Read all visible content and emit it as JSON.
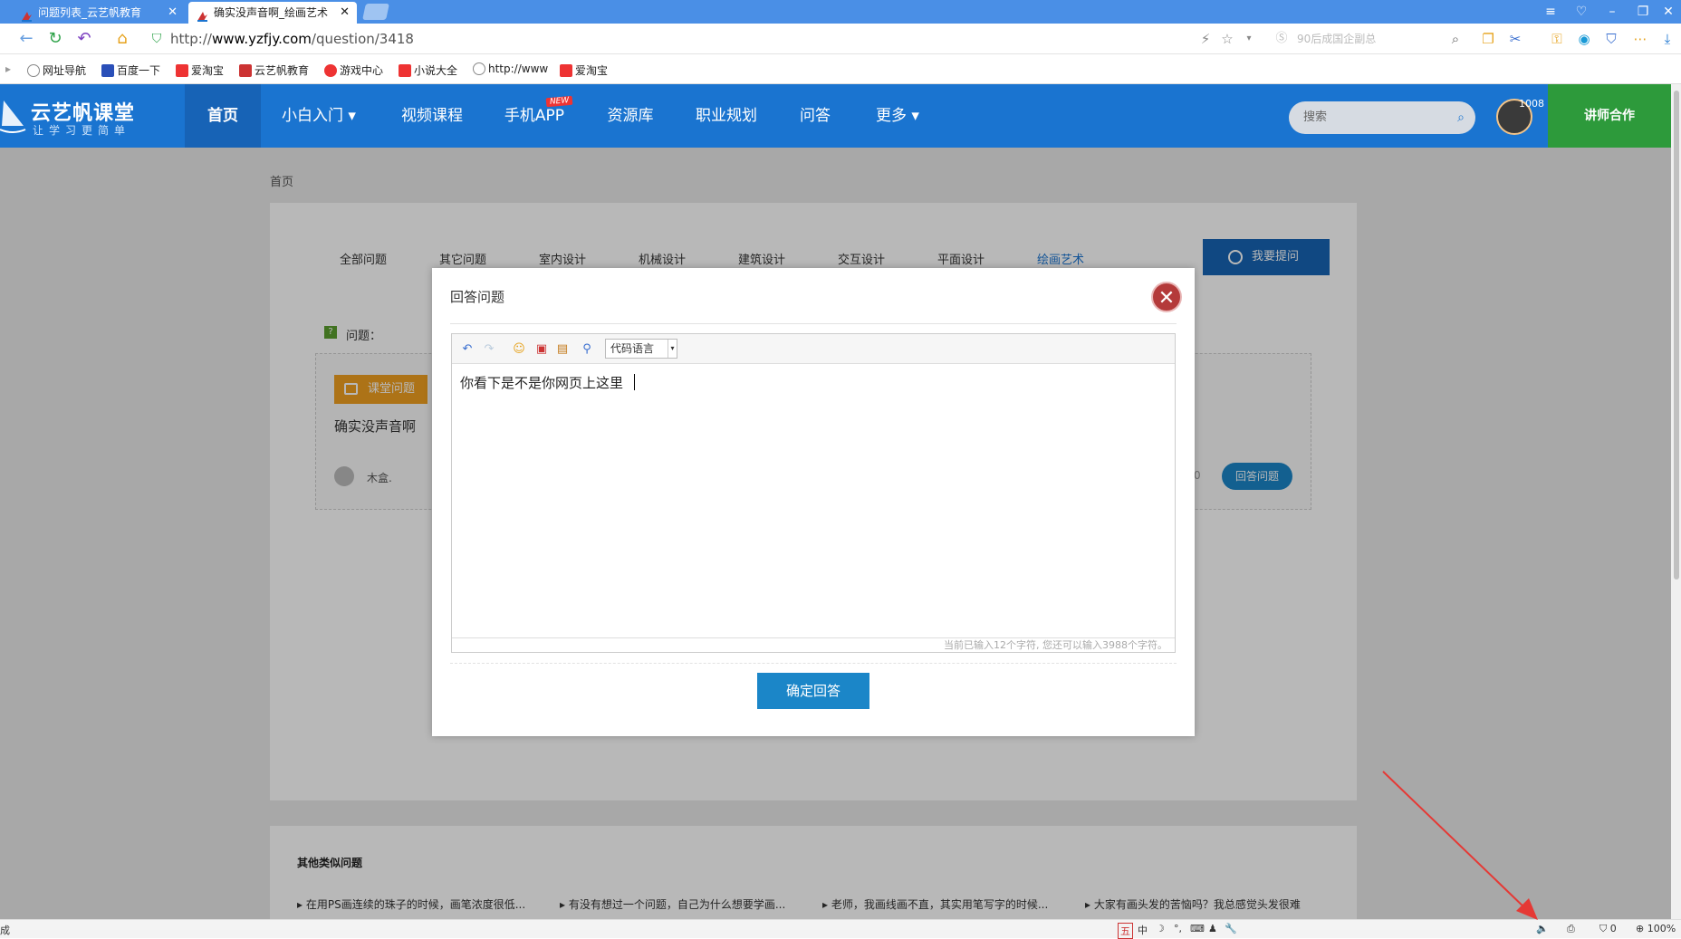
{
  "browser": {
    "tabs": [
      {
        "title": "问题列表_云艺帆教育",
        "active": false
      },
      {
        "title": "确实没声音啊_绘画艺术",
        "active": true
      }
    ],
    "url_prefix": "http://",
    "url_host": "www.yzfjy.com",
    "url_path": "/question/3418",
    "search_placeholder": "90后成国企副总",
    "bookmarks": [
      "网址导航",
      "百度一下",
      "爱淘宝",
      "云艺帆教育",
      "游戏中心",
      "小说大全",
      "http://www",
      "爱淘宝"
    ],
    "status_left": "成",
    "status_zoom": "100%",
    "status_count": "0",
    "ime_items": [
      "五",
      "中",
      "☽",
      "°,",
      "⌨",
      "♟",
      "🔧"
    ]
  },
  "site": {
    "logo_title": "云艺帆课堂",
    "logo_sub": "让学习更简单",
    "nav": [
      "首页",
      "小白入门 ▾",
      "视频课程",
      "手机APP",
      "资源库",
      "职业规划",
      "问答",
      "更多 ▾"
    ],
    "new_badge": "NEW",
    "search_placeholder": "搜索",
    "avatar_count": "1008",
    "partner": "讲师合作"
  },
  "page": {
    "breadcrumb": "首页",
    "categories": [
      "全部问题",
      "其它问题",
      "室内设计",
      "机械设计",
      "建筑设计",
      "交互设计",
      "平面设计",
      "绘画艺术"
    ],
    "ask_button": "我要提问",
    "question_label": "问题：",
    "question_tag": "课堂问题",
    "question_title": "确实没声音啊",
    "question_user": "木盒.",
    "answer_count": "0",
    "answer_button": "回答问题",
    "similar_title": "其他类似问题",
    "similar": [
      "在用PS画连续的珠子的时候，画笔浓度很低...",
      "有没有想过一个问题，自己为什么想要学画...",
      "老师，我画线画不直，其实用笔写字的时候...",
      "大家有画头发的苦恼吗？我总感觉头发很难"
    ]
  },
  "modal": {
    "title": "回答问题",
    "code_language": "代码语言",
    "content": "你看下是不是你网页上这里",
    "counter": "当前已输入12个字符, 您还可以输入3988个字符。",
    "confirm": "确定回答"
  },
  "colors": {
    "header": "#1a74d0",
    "partner": "#2d9a3b",
    "primary_button": "#1b86c8",
    "close_button": "#b43a3a",
    "arrow": "#e53935"
  }
}
